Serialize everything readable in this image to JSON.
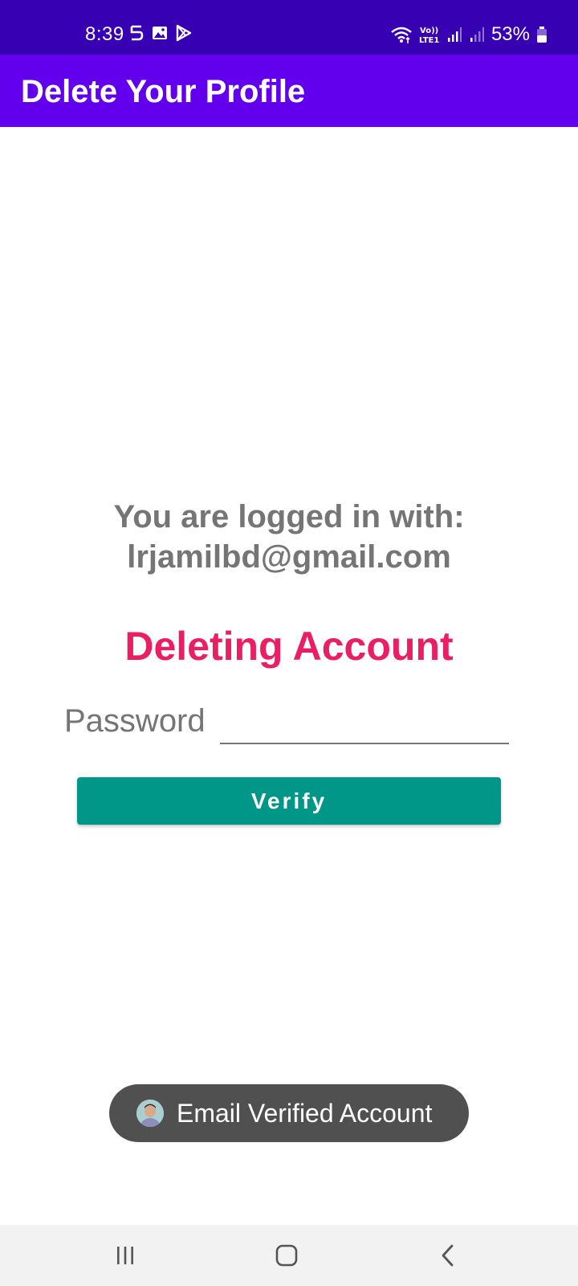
{
  "status_bar": {
    "time": "8:39",
    "battery": "53%",
    "left_icons": [
      "s-notification-icon",
      "gallery-icon",
      "play-store-icon"
    ],
    "right_icons": [
      "wifi-icon",
      "volte-icon",
      "signal-icon",
      "signal-icon-2",
      "battery-icon"
    ],
    "volte_label": "Vo)) LTE1"
  },
  "app_bar": {
    "title": "Delete Your Profile",
    "background": "#6200ee"
  },
  "content": {
    "logged_in_line1": "You are logged in with:",
    "logged_in_line2": "lrjamilbd@gmail.com",
    "deleting_title": "Deleting Account",
    "password_label": "Password",
    "password_value": "",
    "verify_label": "Verify"
  },
  "toast": {
    "text": "Email Verified Account"
  },
  "colors": {
    "status_bar": "#3700b3",
    "app_bar": "#6200ee",
    "accent": "#e91e63",
    "button": "#009688",
    "text_gray": "#757575",
    "toast_bg": "#505050"
  },
  "nav_bar": {
    "icons": [
      "recent-apps-icon",
      "home-icon",
      "back-icon"
    ]
  }
}
